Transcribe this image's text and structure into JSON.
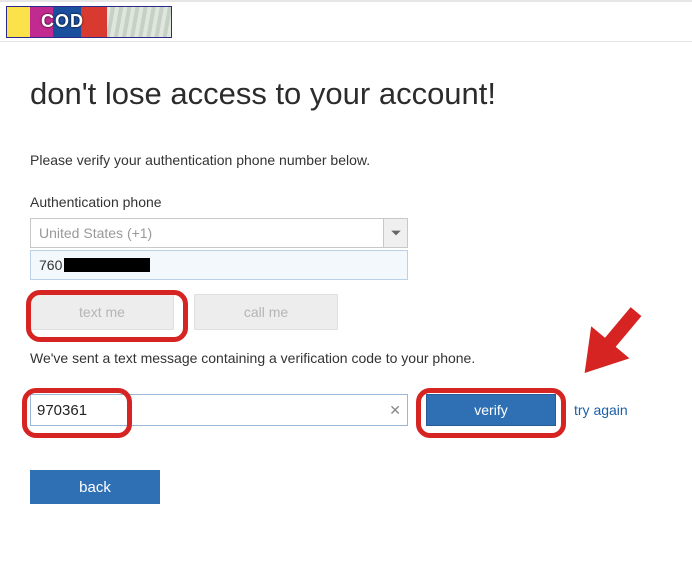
{
  "header": {
    "logo_text": "COD"
  },
  "page": {
    "title": "don't lose access to your account!",
    "instruction": "Please verify your authentication phone number below.",
    "phone_label": "Authentication phone",
    "country_value": "United States (+1)",
    "phone_prefix": "760",
    "text_me_label": "text me",
    "call_me_label": "call me",
    "sent_message": "We've sent a text message containing a verification code to your phone.",
    "code_value": "970361",
    "verify_label": "verify",
    "try_again_label": "try again",
    "back_label": "back"
  }
}
